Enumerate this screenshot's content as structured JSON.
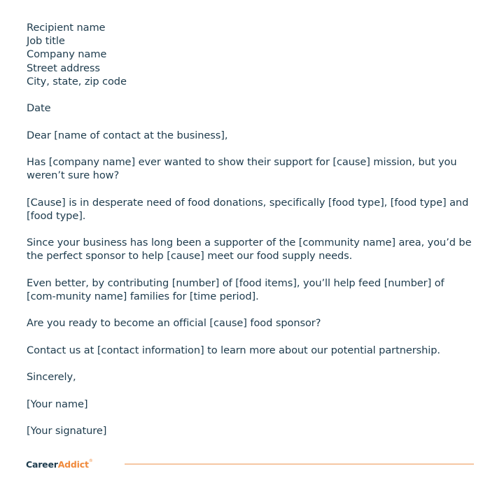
{
  "letter": {
    "address": [
      "Recipient name",
      "Job title",
      "Company name",
      "Street address",
      "City, state, zip code"
    ],
    "date": "Date",
    "salutation": "Dear [name of contact at the business],",
    "paragraphs": [
      "Has [company name] ever wanted to show their support for [cause] mission, but you weren’t sure how?",
      "[Cause] is in desperate need of food donations, specifically [food type], [food type] and [food type].",
      "Since your business has long been a supporter of the [community name] area, you’d be the perfect sponsor to help [cause] meet our food supply needs.",
      "Even better, by contributing [number] of [food items], you’ll help feed [number] of [com-munity name] families for [time period].",
      "Are you ready to become an official [cause] food sponsor?",
      "Contact us at [contact information] to learn more about our potential partnership."
    ],
    "closing": "Sincerely,",
    "name": "[Your name]",
    "signature": "[Your signature]"
  },
  "footer": {
    "logo_part1": "Career",
    "logo_part2": "Addict",
    "logo_mark": "®",
    "accent_color": "#f08a3c",
    "text_color": "#1d3b4d"
  }
}
